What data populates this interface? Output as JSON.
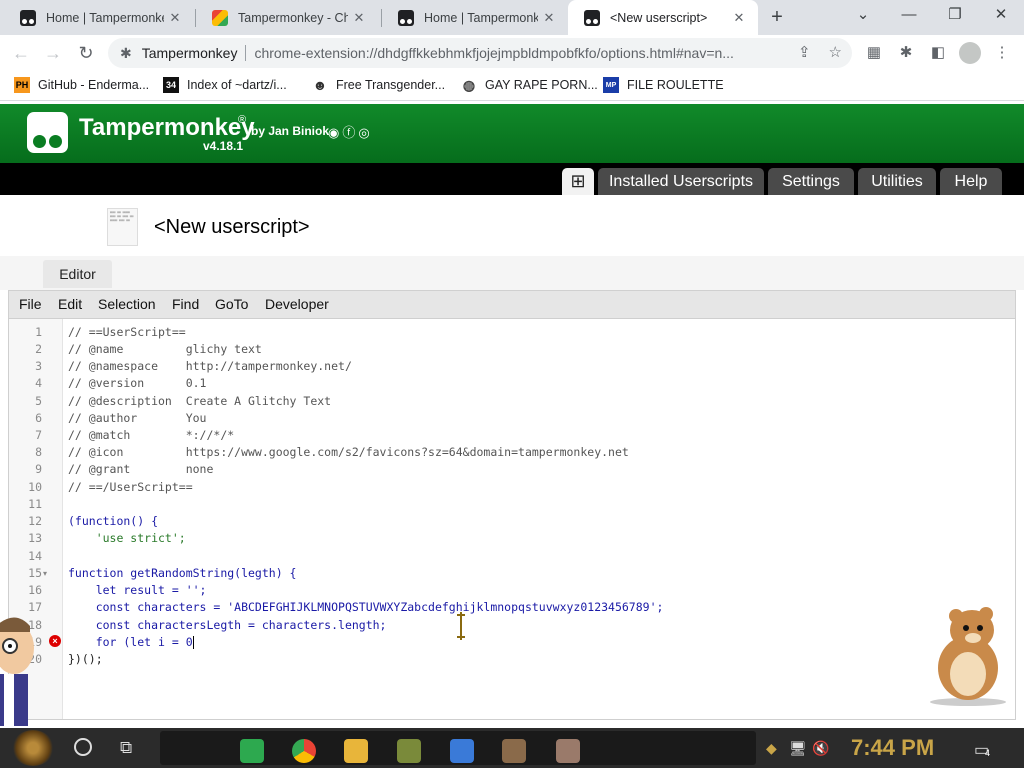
{
  "browser": {
    "tabs": [
      {
        "title": "Home | Tampermonkey",
        "icon": "tampermonkey-icon",
        "active": false
      },
      {
        "title": "Tampermonkey - Chrome Web Store",
        "icon": "chrome-web-store-icon",
        "active": false
      },
      {
        "title": "Home | Tampermonkey",
        "icon": "tampermonkey-icon",
        "active": false
      },
      {
        "title": "<New userscript>",
        "icon": "tampermonkey-icon",
        "active": true
      }
    ],
    "new_tab": "+",
    "window_controls": {
      "dropdown": "⌄",
      "minimize": "—",
      "restore": "❐",
      "close": "✕"
    },
    "omnibox": {
      "site_name": "Tampermonkey",
      "url": "chrome-extension://dhdgffkkebhmkfjojejmpbldmpobfkfo/options.html#nav=n..."
    },
    "bookmarks": [
      {
        "label": "GitHub - Enderma...",
        "icon": "ph-icon",
        "badge": "PH"
      },
      {
        "label": "Index of ~dartz/i...",
        "icon": "terminal-icon",
        "badge": "34"
      },
      {
        "label": "Free Transgender...",
        "icon": "mask-icon",
        "badge": ""
      },
      {
        "label": "GAY RAPE PORN...",
        "icon": "globe-icon",
        "badge": ""
      },
      {
        "label": "FILE ROULETTE",
        "icon": "mp-icon",
        "badge": "MP"
      }
    ]
  },
  "tampermonkey": {
    "brand": "Tampermonkey",
    "registered": "®",
    "author": "by Jan Biniok",
    "version": "v4.18.1",
    "nav": {
      "add": "⊞",
      "items": [
        "Installed Userscripts",
        "Settings",
        "Utilities",
        "Help"
      ]
    },
    "script_title": "<New userscript>",
    "editor_tab": "Editor",
    "menu": [
      "File",
      "Edit",
      "Selection",
      "Find",
      "GoTo",
      "Developer"
    ]
  },
  "code": {
    "line_numbers": [
      "1",
      "2",
      "3",
      "4",
      "5",
      "6",
      "7",
      "8",
      "9",
      "10",
      "11",
      "12",
      "13",
      "14",
      "15",
      "16",
      "17",
      "18",
      "19",
      "20"
    ],
    "lines": [
      "// ==UserScript==",
      "// @name         glichy text",
      "// @namespace    http://tampermonkey.net/",
      "// @version      0.1",
      "// @description  Create A Glitchy Text",
      "// @author       You",
      "// @match        *://*/*",
      "// @icon         https://www.google.com/s2/favicons?sz=64&domain=tampermonkey.net",
      "// @grant        none",
      "// ==/UserScript==",
      "",
      "(function() {",
      "    'use strict';",
      "",
      "function getRandomString(legth) {",
      "    let result = '';",
      "    const characters = 'ABCDEFGHIJKLMNOPQSTUVWXYZabcdefghijklmnopqstuvwxyz0123456789';",
      "    const charactersLegth = characters.length;",
      "    for (let i = 0",
      "})();"
    ],
    "error_line": 19,
    "error_marker": "×",
    "fold_marker": "▾"
  },
  "taskbar": {
    "clock": "7:44 PM",
    "notification_count": "4"
  },
  "colors": {
    "tm_green": "#0a7d22",
    "nav_black": "#000000",
    "nav_button": "#4a4a4a",
    "clock_gold": "#c9a548"
  }
}
